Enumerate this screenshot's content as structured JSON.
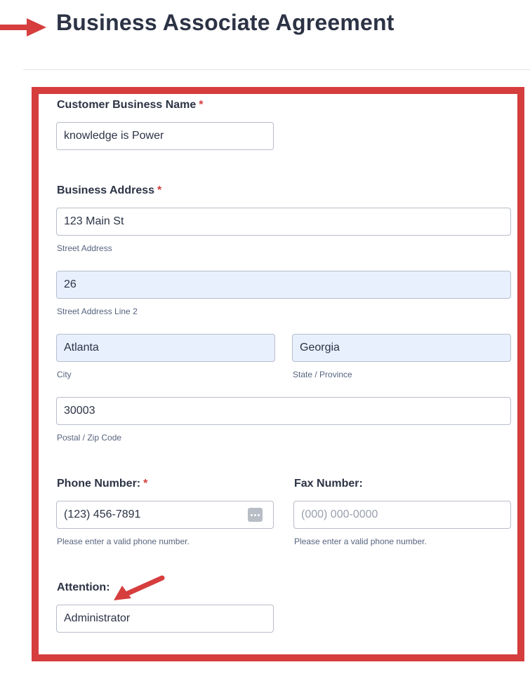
{
  "page": {
    "title": "Business Associate Agreement"
  },
  "form": {
    "customer_business_name": {
      "label": "Customer Business Name",
      "required_mark": "*",
      "value": "knowledge is Power"
    },
    "business_address": {
      "label": "Business Address",
      "required_mark": "*",
      "street": {
        "value": "123 Main St",
        "sublabel": "Street Address"
      },
      "street2": {
        "value": "26",
        "sublabel": "Street Address Line 2"
      },
      "city": {
        "value": "Atlanta",
        "sublabel": "City"
      },
      "state": {
        "value": "Georgia",
        "sublabel": "State / Province"
      },
      "postal": {
        "value": "30003",
        "sublabel": "Postal / Zip Code"
      }
    },
    "phone": {
      "label": "Phone Number:",
      "required_mark": "*",
      "value": "(123) 456-7891",
      "hint": "Please enter a valid phone number.",
      "icon": "ellipsis-icon"
    },
    "fax": {
      "label": "Fax Number:",
      "value": "",
      "placeholder": "(000) 000-0000",
      "hint": "Please enter a valid phone number."
    },
    "attention": {
      "label": "Attention:",
      "value": "Administrator"
    }
  },
  "annotations": {
    "arrow_color": "#d63d3d",
    "highlight_color": "#d63d3d"
  }
}
